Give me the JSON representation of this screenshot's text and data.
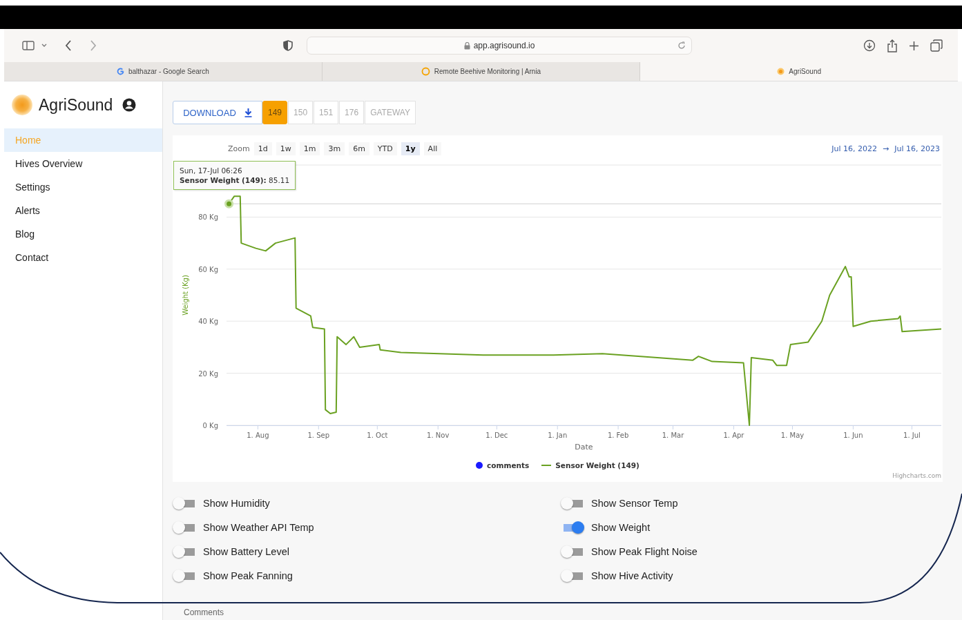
{
  "browser": {
    "url": "app.agrisound.io",
    "tabs": [
      {
        "label": "balthazar - Google Search",
        "kind": "google",
        "selected": false
      },
      {
        "label": "Remote Beehive Monitoring | Arnia",
        "kind": "ring",
        "selected": false
      },
      {
        "label": "AgriSound",
        "kind": "sun",
        "selected": true
      }
    ]
  },
  "sidebar": {
    "brand": "AgriSound",
    "items": [
      {
        "label": "Home",
        "selected": true
      },
      {
        "label": "Hives Overview",
        "selected": false
      },
      {
        "label": "Settings",
        "selected": false
      },
      {
        "label": "Alerts",
        "selected": false
      },
      {
        "label": "Blog",
        "selected": false
      },
      {
        "label": "Contact",
        "selected": false
      }
    ]
  },
  "toolbar": {
    "download": "DOWNLOAD",
    "devices": [
      {
        "label": "149",
        "selected": true
      },
      {
        "label": "150",
        "selected": false
      },
      {
        "label": "151",
        "selected": false
      },
      {
        "label": "176",
        "selected": false
      },
      {
        "label": "GATEWAY",
        "selected": false
      }
    ]
  },
  "chart": {
    "zoom_label": "Zoom",
    "zoom_buttons": [
      {
        "label": "1d",
        "selected": false
      },
      {
        "label": "1w",
        "selected": false
      },
      {
        "label": "1m",
        "selected": false
      },
      {
        "label": "3m",
        "selected": false
      },
      {
        "label": "6m",
        "selected": false
      },
      {
        "label": "YTD",
        "selected": false
      },
      {
        "label": "1y",
        "selected": true
      },
      {
        "label": "All",
        "selected": false
      }
    ],
    "range_from": "Jul 16, 2022",
    "range_arrow": "→",
    "range_to": "Jul 16, 2023",
    "tooltip": {
      "date": "Sun, 17-Jul 06:26",
      "value": "**Sensor Weight (149):** 85.11"
    },
    "legend_extra": {
      "label": "comments",
      "color": "#1a1aff"
    },
    "credit": "Highcharts.com",
    "chart_data": {
      "type": "line",
      "xlabel": "Date",
      "ylabel": "Weight (Kg)",
      "grid": true,
      "ref_lines": [
        {
          "axis": "y",
          "value": 85.11
        }
      ],
      "xlim": [
        "2022-07-16",
        "2023-07-16"
      ],
      "ylim": [
        0,
        100
      ],
      "xticks": [
        {
          "value": "2022-08-01",
          "label": "1. Aug"
        },
        {
          "value": "2022-09-01",
          "label": "1. Sep"
        },
        {
          "value": "2022-10-01",
          "label": "1. Oct"
        },
        {
          "value": "2022-11-01",
          "label": "1. Nov"
        },
        {
          "value": "2022-12-01",
          "label": "1. Dec"
        },
        {
          "value": "2023-01-01",
          "label": "1. Jan"
        },
        {
          "value": "2023-02-01",
          "label": "1. Feb"
        },
        {
          "value": "2023-03-01",
          "label": "1. Mar"
        },
        {
          "value": "2023-04-01",
          "label": "1. Apr"
        },
        {
          "value": "2023-05-01",
          "label": "1. May"
        },
        {
          "value": "2023-06-01",
          "label": "1. Jun"
        },
        {
          "value": "2023-07-01",
          "label": "1. Jul"
        }
      ],
      "yticks": [
        {
          "value": 0,
          "label": "0 Kg"
        },
        {
          "value": 20,
          "label": "20 Kg"
        },
        {
          "value": 40,
          "label": "40 Kg"
        },
        {
          "value": 60,
          "label": "60 Kg"
        },
        {
          "value": 80,
          "label": "80 Kg"
        }
      ],
      "x": [
        "2022-07-17T06:26",
        "2022-07-20",
        "2022-07-23",
        "2022-07-23T12:00",
        "2022-07-31",
        "2022-08-05",
        "2022-08-10",
        "2022-08-20",
        "2022-08-20T12:00",
        "2022-08-28",
        "2022-08-29",
        "2022-09-04",
        "2022-09-04T12:00",
        "2022-09-07",
        "2022-09-10",
        "2022-09-10T12:00",
        "2022-09-15",
        "2022-09-19",
        "2022-09-22",
        "2022-10-02",
        "2022-10-02T12:00",
        "2022-10-13",
        "2022-11-24",
        "2022-12-30",
        "2023-01-24",
        "2023-02-21",
        "2023-03-11",
        "2023-03-14",
        "2023-03-21",
        "2023-04-06",
        "2023-04-09",
        "2023-04-10",
        "2023-04-21",
        "2023-04-23",
        "2023-04-28",
        "2023-04-30",
        "2023-05-09",
        "2023-05-16",
        "2023-05-20",
        "2023-05-28",
        "2023-05-30",
        "2023-05-31",
        "2023-06-01",
        "2023-06-10",
        "2023-06-24",
        "2023-06-25",
        "2023-06-26",
        "2023-07-16"
      ],
      "series": [
        {
          "name": "Sensor Weight (149)",
          "color": "#6aa121",
          "values": [
            85.11,
            88,
            88,
            70,
            68,
            67,
            70,
            72,
            45,
            42,
            37.6,
            37,
            6,
            4.5,
            5,
            34,
            31,
            34,
            30,
            31,
            29,
            28,
            27,
            27,
            27.5,
            26,
            25,
            26.5,
            24.5,
            24,
            0,
            26,
            25,
            23,
            23,
            31,
            32,
            40,
            50,
            61,
            57,
            57,
            38,
            40,
            41,
            42,
            36,
            37
          ]
        }
      ]
    }
  },
  "toggle_columns": [
    [
      {
        "label": "Show Humidity",
        "on": false
      },
      {
        "label": "Show Weather API Temp",
        "on": false
      },
      {
        "label": "Show Battery Level",
        "on": false
      },
      {
        "label": "Show Peak Fanning",
        "on": false
      }
    ],
    [
      {
        "label": "Show Sensor Temp",
        "on": false
      },
      {
        "label": "Show Weight",
        "on": true
      },
      {
        "label": "Show Peak Flight Noise",
        "on": false
      },
      {
        "label": "Show Hive Activity",
        "on": false
      }
    ]
  ],
  "comments_heading": "Comments"
}
